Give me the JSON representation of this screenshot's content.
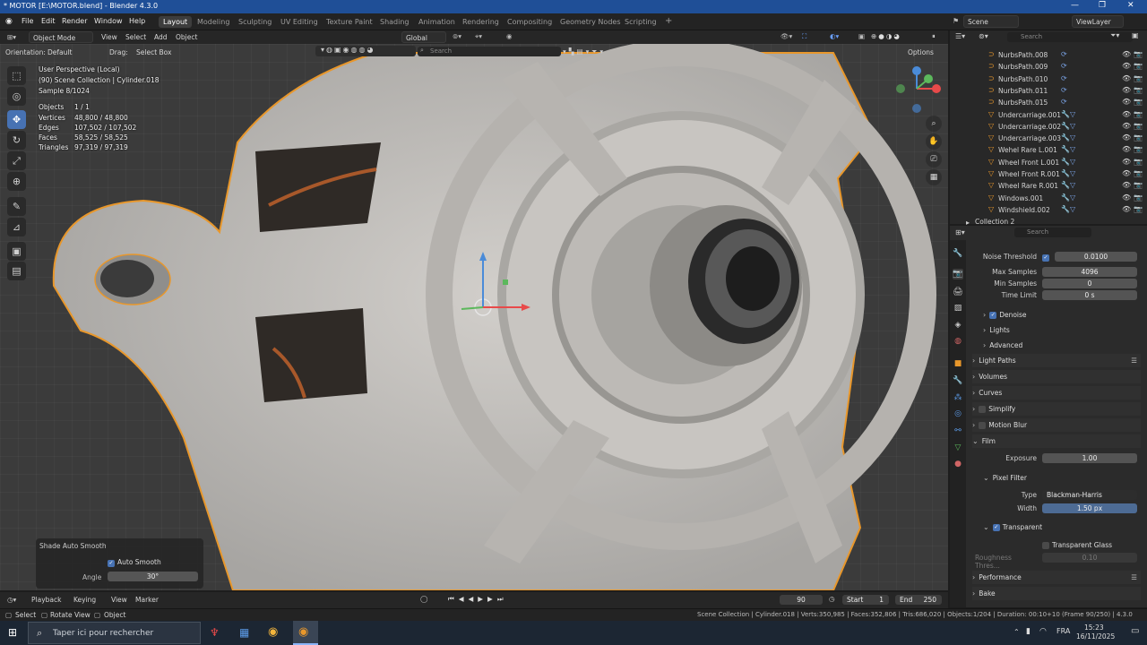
{
  "window": {
    "title": "* MOTOR [E:\\MOTOR.blend] - Blender 4.3.0"
  },
  "menu": {
    "items": [
      "File",
      "Edit",
      "Render",
      "Window",
      "Help"
    ]
  },
  "workspaces": [
    "Layout",
    "Modeling",
    "Sculpting",
    "UV Editing",
    "Texture Paint",
    "Shading",
    "Animation",
    "Rendering",
    "Compositing",
    "Geometry Nodes",
    "Scripting"
  ],
  "active_workspace": "Layout",
  "scene_selector": {
    "scene": "Scene",
    "view_layer": "ViewLayer"
  },
  "viewport_header": {
    "mode": "Object Mode",
    "menus": [
      "View",
      "Select",
      "Add",
      "Object"
    ],
    "orientation_label": "Orientation:",
    "orientation_value": "Default",
    "drag_label": "Drag:",
    "drag_value": "Select Box",
    "transform_orientation": "Global",
    "search_placeholder": "Search",
    "options_label": "Options"
  },
  "viewport_info": {
    "perspective": "User Perspective (Local)",
    "collection": "(90) Scene Collection | Cylinder.018",
    "sample": "Sample 8/1024",
    "stats": [
      {
        "label": "Objects",
        "value": "1 / 1"
      },
      {
        "label": "Vertices",
        "value": "48,800 / 48,800"
      },
      {
        "label": "Edges",
        "value": "107,502 / 107,502"
      },
      {
        "label": "Faces",
        "value": "58,525 / 58,525"
      },
      {
        "label": "Triangles",
        "value": "97,319 / 97,319"
      }
    ]
  },
  "operator_panel": {
    "title": "Shade Auto Smooth",
    "checkbox_label": "Auto Smooth",
    "angle_label": "Angle",
    "angle_value": "30°"
  },
  "timeline": {
    "menus": [
      "Playback",
      "Keying",
      "View",
      "Marker"
    ],
    "current_frame": "90",
    "start_label": "Start",
    "start_value": "1",
    "end_label": "End",
    "end_value": "250"
  },
  "statusbar": {
    "left": [
      "Select",
      "Rotate View",
      "Object"
    ],
    "info": "Scene Collection | Cylinder.018 | Verts:350,985 | Faces:352,806 | Tris:686,020 | Objects:1/204 | Duration: 00:10+10 (Frame 90/250) | 4.3.0"
  },
  "outliner": {
    "search_placeholder": "Search",
    "items": [
      {
        "name": "NurbsPath.008",
        "kind": "curve"
      },
      {
        "name": "NurbsPath.009",
        "kind": "curve"
      },
      {
        "name": "NurbsPath.010",
        "kind": "curve"
      },
      {
        "name": "NurbsPath.011",
        "kind": "curve"
      },
      {
        "name": "NurbsPath.015",
        "kind": "curve"
      },
      {
        "name": "Undercarriage.001",
        "kind": "mesh"
      },
      {
        "name": "Undercarriage.002",
        "kind": "mesh"
      },
      {
        "name": "Undercarriage.003",
        "kind": "mesh"
      },
      {
        "name": "Wehel Rare L.001",
        "kind": "mesh"
      },
      {
        "name": "Wheel Front L.001",
        "kind": "mesh"
      },
      {
        "name": "Wheel Front R.001",
        "kind": "mesh"
      },
      {
        "name": "Wheel Rare R.001",
        "kind": "mesh"
      },
      {
        "name": "Windows.001",
        "kind": "mesh"
      },
      {
        "name": "Windshield.002",
        "kind": "mesh"
      }
    ],
    "collection_row": "Collection 2"
  },
  "properties": {
    "search_placeholder": "Search",
    "noise_threshold": {
      "label": "Noise Threshold",
      "value": "0.0100"
    },
    "max_samples": {
      "label": "Max Samples",
      "value": "4096"
    },
    "min_samples": {
      "label": "Min Samples",
      "value": "0"
    },
    "time_limit": {
      "label": "Time Limit",
      "value": "0 s"
    },
    "sub_panels": [
      "Denoise",
      "Lights",
      "Advanced"
    ],
    "panels": [
      "Light Paths",
      "Volumes",
      "Curves",
      "Simplify",
      "Motion Blur",
      "Film"
    ],
    "exposure": {
      "label": "Exposure",
      "value": "1.00"
    },
    "pixel_filter": "Pixel Filter",
    "filter_type": {
      "label": "Type",
      "value": "Blackman-Harris"
    },
    "filter_width": {
      "label": "Width",
      "value": "1.50 px"
    },
    "transparent": "Transparent",
    "transparent_glass": "Transparent Glass",
    "roughness": {
      "label": "Roughness Thres...",
      "value": "0.10"
    },
    "bottom_panels": [
      "Performance",
      "Bake"
    ]
  },
  "taskbar": {
    "search_placeholder": "Taper ici pour rechercher",
    "language": "FRA",
    "time": "15:23",
    "date": "16/11/2025"
  },
  "colors": {
    "accent": "#4772b3",
    "selection_outline": "#e8972b",
    "titlebar": "#1f4f97"
  }
}
